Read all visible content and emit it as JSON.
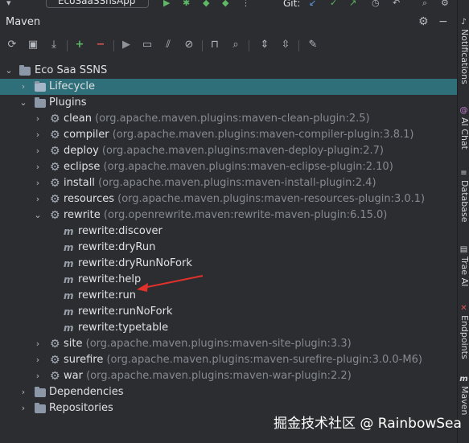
{
  "topbar": {
    "run_config": "EcoSaaSSnsApp",
    "vcs_label": "Git:"
  },
  "panel": {
    "title": "Maven"
  },
  "toolbar": {
    "items": [
      "reload-icon",
      "add-project-icon",
      "download-icon",
      "plus-icon",
      "minus-icon",
      "run-icon",
      "execute-goal-icon",
      "toggle-offline-icon",
      "skip-tests-icon",
      "show-dependencies-icon",
      "expand-all-icon",
      "collapse-all-icon",
      "settings-wrench-icon"
    ]
  },
  "tree": {
    "project": "Eco Saa SSNS",
    "lifecycle": "Lifecycle",
    "plugins_label": "Plugins",
    "plugins": [
      {
        "name": "clean",
        "coord": "(org.apache.maven.plugins:maven-clean-plugin:2.5)"
      },
      {
        "name": "compiler",
        "coord": "(org.apache.maven.plugins:maven-compiler-plugin:3.8.1)"
      },
      {
        "name": "deploy",
        "coord": "(org.apache.maven.plugins:maven-deploy-plugin:2.7)"
      },
      {
        "name": "eclipse",
        "coord": "(org.apache.maven.plugins:maven-eclipse-plugin:2.10)"
      },
      {
        "name": "install",
        "coord": "(org.apache.maven.plugins:maven-install-plugin:2.4)"
      },
      {
        "name": "resources",
        "coord": "(org.apache.maven.plugins:maven-resources-plugin:3.0.1)"
      },
      {
        "name": "rewrite",
        "coord": "(org.openrewrite.maven:rewrite-maven-plugin:6.15.0)"
      }
    ],
    "rewrite_goals": [
      "rewrite:discover",
      "rewrite:dryRun",
      "rewrite:dryRunNoFork",
      "rewrite:help",
      "rewrite:run",
      "rewrite:runNoFork",
      "rewrite:typetable"
    ],
    "plugins_after": [
      {
        "name": "site",
        "coord": "(org.apache.maven.plugins:maven-site-plugin:3.3)"
      },
      {
        "name": "surefire",
        "coord": "(org.apache.maven.plugins:maven-surefire-plugin:3.0.0-M6)"
      },
      {
        "name": "war",
        "coord": "(org.apache.maven.plugins:maven-war-plugin:2.2)"
      }
    ],
    "dependencies": "Dependencies",
    "repositories": "Repositories"
  },
  "right_stripe": {
    "notifications": "Notifications",
    "ai_chat": "AI Chat",
    "database": "Database",
    "trae_ai": "Trae AI",
    "endpoints": "Endpoints",
    "maven": "Maven"
  },
  "watermark": "掘金技术社区 @ RainbowSea",
  "colors": {
    "background": "#2b2d30",
    "selection": "#2e6f79",
    "annotation_arrow": "#e0312a",
    "text": "#dfe1e5",
    "muted": "#868a91"
  }
}
